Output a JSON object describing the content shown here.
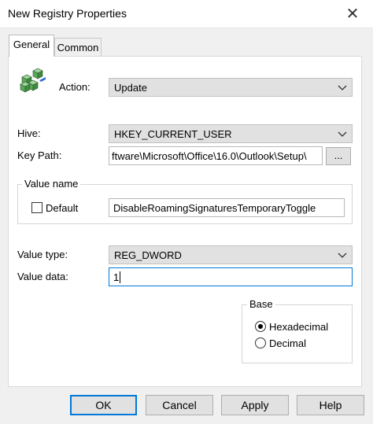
{
  "window": {
    "title": "New Registry Properties",
    "close_glyph": "✕"
  },
  "tabs": [
    {
      "label": "General",
      "selected": true
    },
    {
      "label": "Common",
      "selected": false
    }
  ],
  "action": {
    "label": "Action:",
    "value": "Update"
  },
  "hive": {
    "label": "Hive:",
    "value": "HKEY_CURRENT_USER"
  },
  "key_path": {
    "label": "Key Path:",
    "value": "ftware\\Microsoft\\Office\\16.0\\Outlook\\Setup\\",
    "browse_label": "..."
  },
  "value_name": {
    "group_label": "Value name",
    "default_label": "Default",
    "default_checked": false,
    "value": "DisableRoamingSignaturesTemporaryToggle"
  },
  "value_type": {
    "label": "Value type:",
    "value": "REG_DWORD"
  },
  "value_data": {
    "label": "Value data:",
    "value": "1"
  },
  "base": {
    "group_label": "Base",
    "options": [
      {
        "label": "Hexadecimal",
        "checked": true
      },
      {
        "label": "Decimal",
        "checked": false
      }
    ]
  },
  "buttons": {
    "ok": "OK",
    "cancel": "Cancel",
    "apply": "Apply",
    "help": "Help"
  },
  "colors": {
    "accent": "#0078d7",
    "dialog_bg": "#f0f0f0",
    "combo_bg": "#e1e1e1"
  },
  "icons": {
    "registry": "registry-cubes-icon",
    "chevron": "chevron-down-icon",
    "close": "close-icon"
  }
}
